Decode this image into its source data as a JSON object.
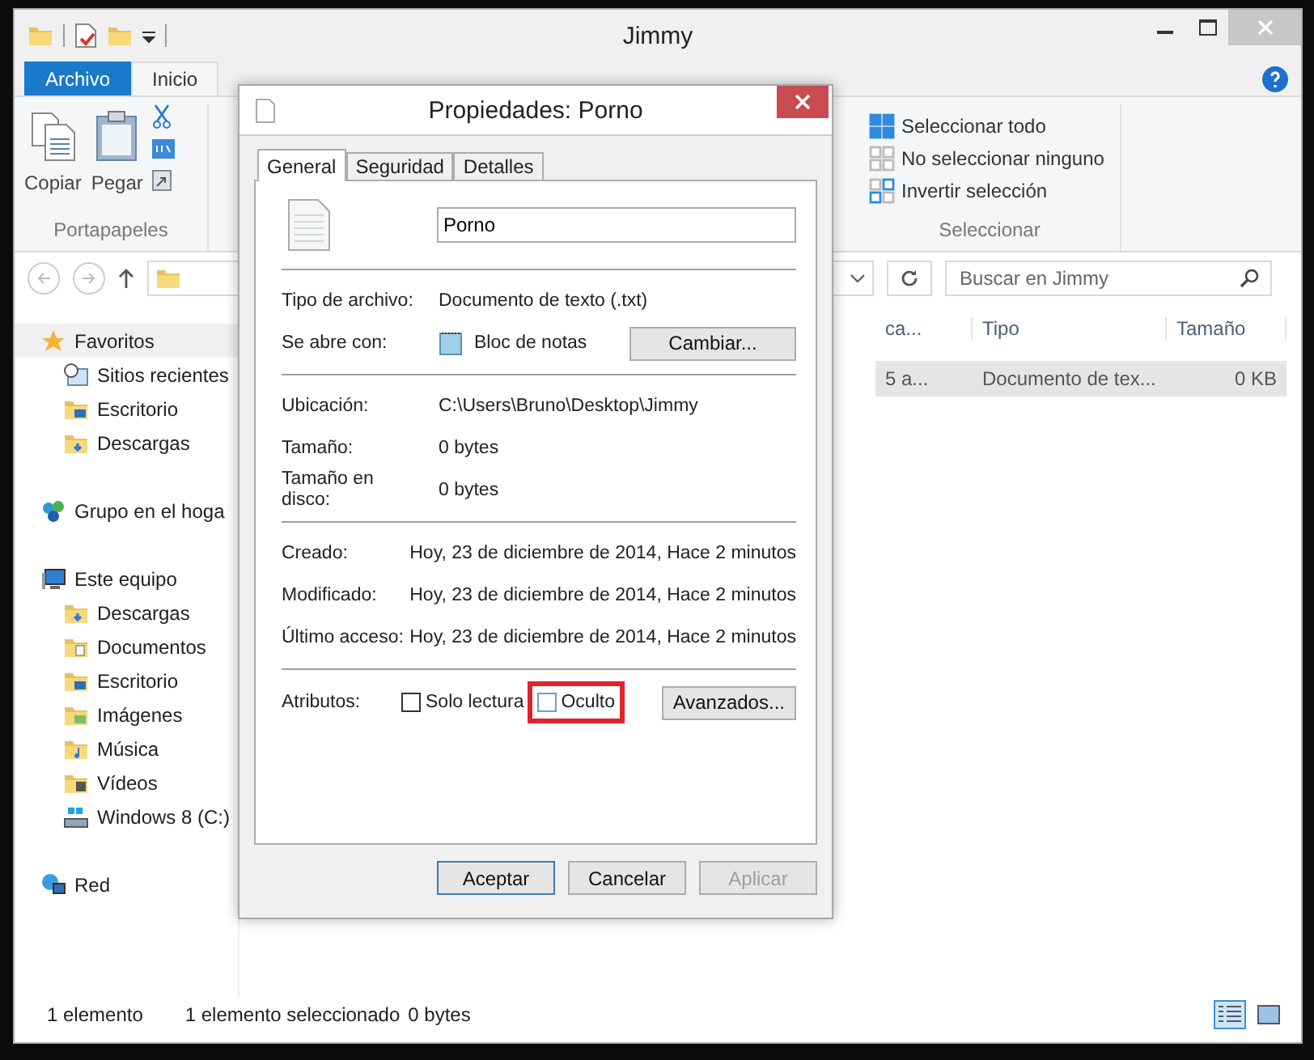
{
  "explorer": {
    "title": "Jimmy",
    "ribbon_tabs": [
      {
        "label": "Archivo",
        "kind": "file",
        "selected": false
      },
      {
        "label": "Inicio",
        "kind": "tab",
        "selected": true
      }
    ],
    "clipboard": {
      "buttons": [
        {
          "label": "Copiar",
          "kind": "copy"
        },
        {
          "label": "Pegar",
          "kind": "paste"
        }
      ],
      "label": "Portapapeles"
    },
    "select": {
      "items": [
        {
          "label": "Seleccionar todo",
          "kind": "all"
        },
        {
          "label": "No seleccionar ninguno",
          "kind": "none"
        },
        {
          "label": "Invertir selección",
          "kind": "invert"
        }
      ],
      "label": "Seleccionar"
    },
    "search": {
      "placeholder": "Buscar en Jimmy"
    },
    "sidebar": [
      {
        "label": "Favoritos",
        "kind": "star",
        "selected": true,
        "children": [
          {
            "label": "Sitios recientes",
            "kind": "recent",
            "selected": false
          },
          {
            "label": "Escritorio",
            "kind": "desktop",
            "selected": false
          },
          {
            "label": "Descargas",
            "kind": "download",
            "selected": false
          }
        ]
      },
      {
        "label": "Grupo en el hoga",
        "kind": "homegroup",
        "selected": false
      },
      {
        "label": "Este equipo",
        "kind": "computer",
        "selected": false,
        "children": [
          {
            "label": "Descargas",
            "kind": "download",
            "selected": false
          },
          {
            "label": "Documentos",
            "kind": "documents",
            "selected": false
          },
          {
            "label": "Escritorio",
            "kind": "desktop",
            "selected": false
          },
          {
            "label": "Imágenes",
            "kind": "pictures",
            "selected": false
          },
          {
            "label": "Música",
            "kind": "music",
            "selected": false
          },
          {
            "label": "Vídeos",
            "kind": "videos",
            "selected": false
          },
          {
            "label": "Windows 8 (C:)",
            "kind": "drive",
            "selected": false
          }
        ]
      },
      {
        "label": "Red",
        "kind": "network",
        "selected": false
      }
    ],
    "table": {
      "columns": [
        "ca...",
        "Tipo",
        "Tamaño"
      ],
      "rows": [
        {
          "cells": [
            "5 a...",
            "Documento de tex...",
            "0 KB"
          ],
          "selected": true
        }
      ]
    },
    "status_bar": {
      "count": "1 elemento",
      "selection": "1 elemento seleccionado",
      "size": "0 bytes",
      "views": [
        {
          "kind": "details",
          "selected": true
        },
        {
          "kind": "thumbnails",
          "selected": false
        }
      ]
    }
  },
  "dialog": {
    "title": "Propiedades: Porno",
    "tabs": [
      {
        "label": "General",
        "selected": true
      },
      {
        "label": "Seguridad",
        "selected": false
      },
      {
        "label": "Detalles",
        "selected": false
      }
    ],
    "name": "Porno",
    "sections": [
      [
        {
          "label": "Tipo de archivo:",
          "value": "Documento de texto (.txt)"
        },
        {
          "label": "Se abre con:",
          "value": "Bloc de notas",
          "kind": "app",
          "button": "Cambiar..."
        }
      ],
      [
        {
          "label": "Ubicación:",
          "value": "C:\\Users\\Bruno\\Desktop\\Jimmy"
        },
        {
          "label": "Tamaño:",
          "value": "0 bytes"
        },
        {
          "label": "Tamaño en disco:",
          "value": "0 bytes"
        }
      ],
      [
        {
          "label": "Creado:",
          "value": "Hoy, 23 de diciembre de 2014, Hace 2 minutos"
        },
        {
          "label": "Modificado:",
          "value": "Hoy, 23 de diciembre de 2014, Hace 2 minutos"
        },
        {
          "label": "Último acceso:",
          "value": "Hoy, 23 de diciembre de 2014, Hace 2 minutos"
        }
      ]
    ],
    "attributes": {
      "label": "Atributos:",
      "items": [
        {
          "label": "Solo lectura",
          "checked": false,
          "highlighted": false
        },
        {
          "label": "Oculto",
          "checked": false,
          "highlighted": true
        }
      ],
      "button": "Avanzados..."
    },
    "buttons": [
      {
        "label": "Aceptar",
        "default": true,
        "disabled": false
      },
      {
        "label": "Cancelar",
        "default": false,
        "disabled": false
      },
      {
        "label": "Aplicar",
        "default": false,
        "disabled": true
      }
    ]
  }
}
